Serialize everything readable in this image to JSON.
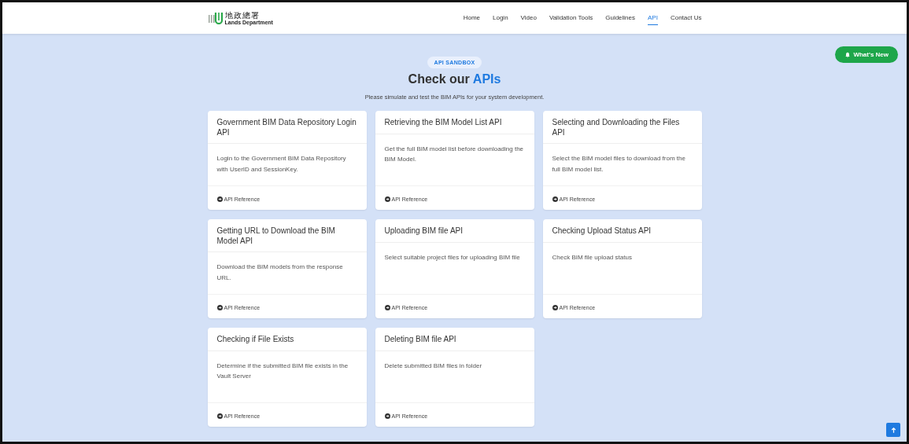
{
  "header": {
    "logo": {
      "chinese": "地政總署",
      "english": "Lands Department"
    },
    "nav": [
      {
        "label": "Home",
        "selected": false
      },
      {
        "label": "Login",
        "selected": false
      },
      {
        "label": "Video",
        "selected": false
      },
      {
        "label": "Validation Tools",
        "selected": false
      },
      {
        "label": "Guidelines",
        "selected": false
      },
      {
        "label": "API",
        "selected": true
      },
      {
        "label": "Contact Us",
        "selected": false
      }
    ]
  },
  "whats_new": "What's New",
  "intro": {
    "badge": "API SANDBOX",
    "heading": "Check our",
    "heading_highlight": "APIs",
    "subtitle": "Please simulate and test the BIM APIs for your system development."
  },
  "cards": [
    {
      "title": "Government BIM Data Repository Login API",
      "description": "Login to the Government BIM Data Repository with UserID and SessionKey.",
      "link": "API Reference"
    },
    {
      "title": "Retrieving the BIM Model List API",
      "description": "Get the full BIM model list before downloading the BIM Model.",
      "link": "API Reference"
    },
    {
      "title": "Selecting and Downloading the Files API",
      "description": "Select the BIM model files to download from the full BIM model list.",
      "link": "API Reference"
    },
    {
      "title": "Getting URL to Download the BIM Model API",
      "description": "Download the BIM models from the response URL.",
      "link": "API Reference"
    },
    {
      "title": "Uploading BIM file API",
      "description": "Select suitable project files for uploading BIM file",
      "link": "API Reference"
    },
    {
      "title": "Checking Upload Status API",
      "description": "Check BIM file upload status",
      "link": "API Reference"
    },
    {
      "title": "Checking if File Exists",
      "description": "Determine if the submitted BIM file exists in the Vault Server",
      "link": "API Reference"
    },
    {
      "title": "Deleting BIM file API",
      "description": "Delete submitted BIM files in folder",
      "link": "API Reference"
    }
  ]
}
